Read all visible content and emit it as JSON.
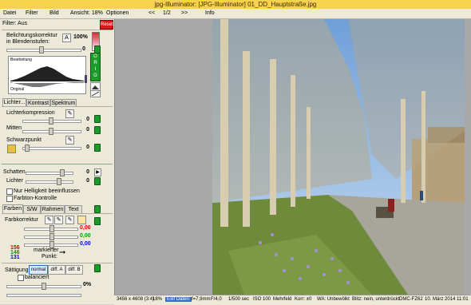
{
  "window": {
    "title": "jpg-Illuminator:   [JPG-Illuminator]  01_DD_Hauptstraße.jpg"
  },
  "menu": {
    "items": [
      "Datei",
      "Filter",
      "Bild",
      "Ansicht: 18%",
      "Optionen",
      "<<",
      "1/2",
      ">>",
      "Info"
    ]
  },
  "panel": {
    "filter_status": "Filter: Aus",
    "reset_label": "Reset",
    "exposure": {
      "label_line1": "Belichtungskorrektur",
      "label_line2": "in Blendenstufen:",
      "auto_button": "A",
      "percent": "100%",
      "value": "0"
    },
    "histogram": {
      "top_label": "Bearbeitung",
      "bottom_label": "Original",
      "orig_letters": [
        "O",
        "R",
        "I",
        "G"
      ]
    },
    "tabs1": [
      "Lichter...",
      "Kontrast",
      "Spektrum"
    ],
    "lichter": {
      "kompression_label": "Lichterkompression",
      "kompression_value": "0",
      "mitten_label": "Mitten",
      "mitten_value": "0",
      "schwarz_label": "Schwarzpunkt",
      "schwarz_value": "0",
      "schatten_label": "Schatten",
      "schatten_value": "0",
      "lichter_label": "Lichter",
      "lichter_value": "0",
      "cb_helligkeit": "Nur Helligkeit beeinflussen",
      "cb_farbton": "Farbton-Kontrolle"
    },
    "tabs2": [
      "Farben",
      "S/W",
      "Rahmen",
      "Text"
    ],
    "farben": {
      "label": "Farbkorrektur",
      "r_value": "0,00",
      "g_value": "0,00",
      "b_value": "0,00",
      "r_color": "#e00000",
      "g_color": "#00a000",
      "b_color": "#0000d0",
      "rgb_r": "156",
      "rgb_g": "146",
      "rgb_b": "131",
      "marked_line1": "markierter",
      "marked_line2": "Punkt:",
      "arrow": "➞",
      "saettigung_label": "Sättigung",
      "mode_buttons": [
        "normal",
        "diff. A",
        "diff. B"
      ],
      "balanciert_label": "balanciert",
      "saettigung_value": "0%"
    }
  },
  "viewer": {
    "photo": "street-with-plane-trees-crocus-lawn"
  },
  "status": {
    "items": [
      "3456 x 4608 (3:4)",
      "18%",
      "Exif Daten:",
      "f=7,9mm",
      "F/4,0",
      "1/500 sec",
      "ISO 100",
      "Mehrfeld",
      "Korr: ±0",
      "WA: Unbewölkt",
      "Blitz: nein, unterdrückt",
      "DMC-FZ62",
      "10. März 2014   11:01"
    ]
  }
}
